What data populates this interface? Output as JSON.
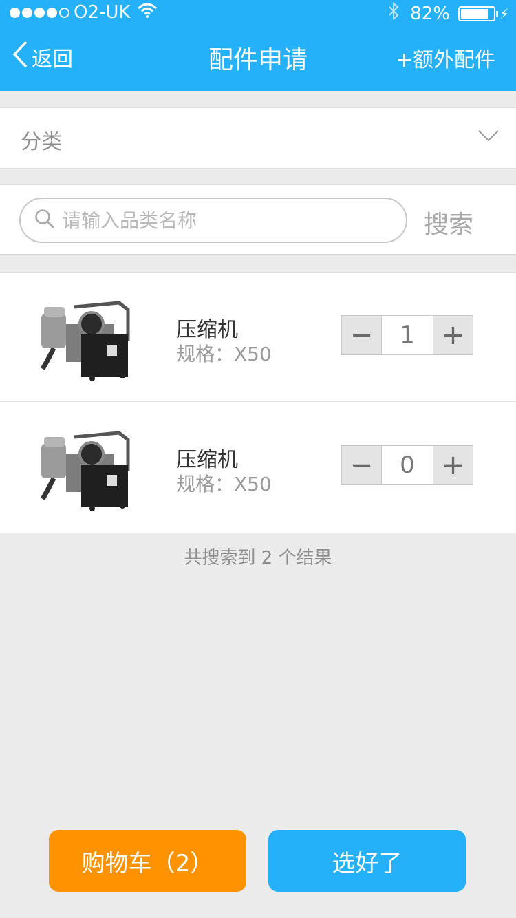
{
  "status": {
    "carrier": "O2-UK",
    "battery": "82%",
    "battery_level": 0.82
  },
  "nav": {
    "back": "返回",
    "title": "配件申请",
    "extra": "+额外配件"
  },
  "category": {
    "label": "分类"
  },
  "search": {
    "placeholder": "请输入品类名称",
    "button": "搜索"
  },
  "items": [
    {
      "name": "压缩机",
      "spec": "规格：X50",
      "qty": "1"
    },
    {
      "name": "压缩机",
      "spec": "规格：X50",
      "qty": "0"
    }
  ],
  "stepper": {
    "minus": "−",
    "plus": "+"
  },
  "results": "共搜索到 2 个结果",
  "buttons": {
    "cart": "购物车（2）",
    "done": "选好了"
  },
  "colors": {
    "brand": "#24b1fa",
    "cart": "#ff9200"
  }
}
